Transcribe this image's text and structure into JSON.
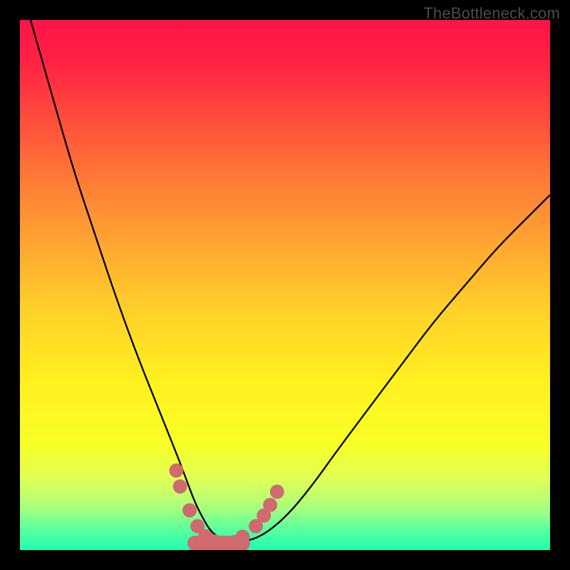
{
  "watermark": "TheBottleneck.com",
  "background": {
    "rainbow_stops": [
      {
        "offset": 0.0,
        "color": "#ff1447"
      },
      {
        "offset": 0.08,
        "color": "#ff2244"
      },
      {
        "offset": 0.18,
        "color": "#ff4a3d"
      },
      {
        "offset": 0.3,
        "color": "#ff7a36"
      },
      {
        "offset": 0.42,
        "color": "#ffa531"
      },
      {
        "offset": 0.55,
        "color": "#ffd129"
      },
      {
        "offset": 0.68,
        "color": "#fff01f"
      },
      {
        "offset": 0.8,
        "color": "#f9ff25"
      },
      {
        "offset": 0.87,
        "color": "#ddff5a"
      },
      {
        "offset": 0.92,
        "color": "#a8ff7d"
      },
      {
        "offset": 0.96,
        "color": "#5cff9e"
      },
      {
        "offset": 1.0,
        "color": "#1dffb0"
      }
    ]
  },
  "chart_data": {
    "type": "line",
    "title": "",
    "xlabel": "",
    "ylabel": "",
    "xlim": [
      0,
      100
    ],
    "ylim": [
      0,
      100
    ],
    "series": [
      {
        "name": "curve",
        "x": [
          2,
          6,
          10,
          14,
          18,
          22,
          26,
          28,
          30,
          31.5,
          33,
          34.5,
          36,
          38,
          41,
          45,
          50,
          55,
          60,
          66,
          72,
          78,
          84,
          90,
          96,
          100
        ],
        "y": [
          100,
          86,
          72,
          60,
          48,
          37,
          27,
          22,
          17,
          13,
          9,
          6,
          3.5,
          2,
          1.5,
          2.2,
          6,
          12,
          19,
          27,
          35,
          43,
          50,
          57,
          63,
          67
        ]
      }
    ],
    "flat_bottom": {
      "x_start": 33,
      "x_end": 42,
      "y": 1.3
    },
    "markers": [
      {
        "x": 29.5,
        "y": 15.0
      },
      {
        "x": 30.2,
        "y": 12.0
      },
      {
        "x": 32.0,
        "y": 7.5
      },
      {
        "x": 33.5,
        "y": 4.5
      },
      {
        "x": 35.0,
        "y": 2.6
      },
      {
        "x": 36.8,
        "y": 1.6
      },
      {
        "x": 38.5,
        "y": 1.3
      },
      {
        "x": 40.5,
        "y": 1.5
      },
      {
        "x": 42.0,
        "y": 2.5
      },
      {
        "x": 44.5,
        "y": 4.5
      },
      {
        "x": 46.0,
        "y": 6.5
      },
      {
        "x": 47.2,
        "y": 8.5
      },
      {
        "x": 48.5,
        "y": 11.0
      }
    ],
    "marker_style": {
      "fill": "#cf6a6f",
      "r": 10
    },
    "flat_style": {
      "stroke": "#cf6a6f",
      "width": 21
    }
  }
}
